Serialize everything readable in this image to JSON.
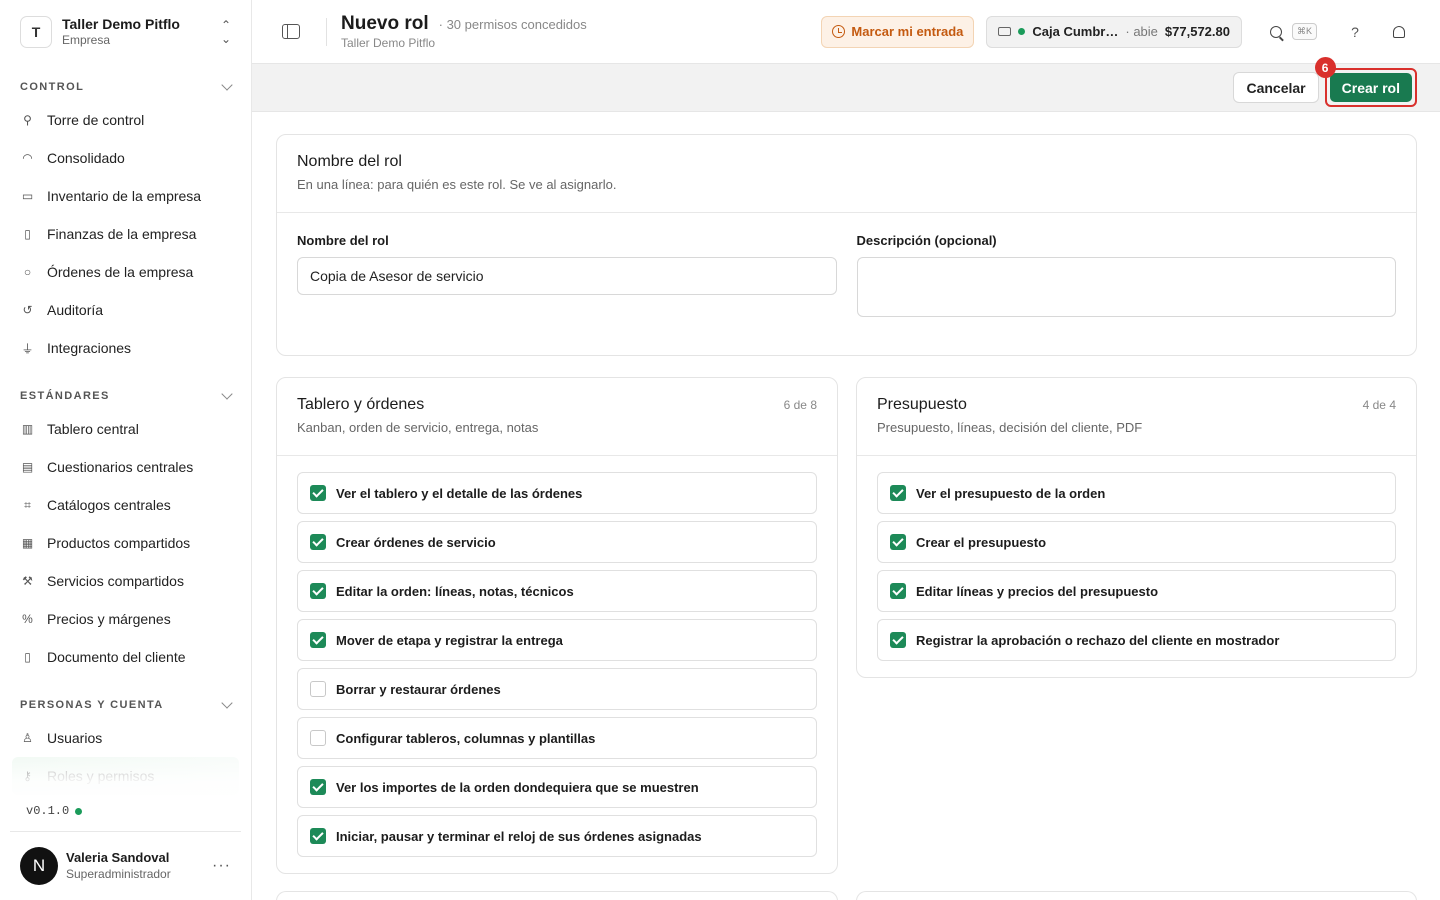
{
  "workspace": {
    "initial": "T",
    "name": "Taller Demo Pitflo",
    "type": "Empresa"
  },
  "sidebar": {
    "sections": [
      {
        "title": "CONTROL",
        "items": [
          {
            "label": "Torre de control",
            "icon": "tower-icon"
          },
          {
            "label": "Consolidado",
            "icon": "gauge-icon"
          },
          {
            "label": "Inventario de la empresa",
            "icon": "inbox-icon"
          },
          {
            "label": "Finanzas de la empresa",
            "icon": "book-icon"
          },
          {
            "label": "Órdenes de la empresa",
            "icon": "search-icon"
          },
          {
            "label": "Auditoría",
            "icon": "history-icon"
          },
          {
            "label": "Integraciones",
            "icon": "plug-icon"
          }
        ]
      },
      {
        "title": "ESTÁNDARES",
        "items": [
          {
            "label": "Tablero central",
            "icon": "columns-icon"
          },
          {
            "label": "Cuestionarios centrales",
            "icon": "clipboard-icon"
          },
          {
            "label": "Catálogos centrales",
            "icon": "workflow-icon"
          },
          {
            "label": "Productos compartidos",
            "icon": "boxes-icon"
          },
          {
            "label": "Servicios compartidos",
            "icon": "wrench-icon"
          },
          {
            "label": "Precios y márgenes",
            "icon": "percent-icon"
          },
          {
            "label": "Documento del cliente",
            "icon": "file-icon"
          }
        ]
      },
      {
        "title": "PERSONAS Y CUENTA",
        "items": [
          {
            "label": "Usuarios",
            "icon": "user-icon"
          },
          {
            "label": "Roles y permisos",
            "icon": "key-icon"
          }
        ]
      }
    ],
    "version": "v0.1.0",
    "user": {
      "initial": "N",
      "name": "Valeria Sandoval",
      "role": "Superadministrador"
    }
  },
  "header": {
    "title": "Nuevo rol",
    "meta": "30 permisos concedidos",
    "subtitle": "Taller Demo Pitflo",
    "clock_in_label": "Marcar mi entrada",
    "register": {
      "name": "Caja Cumbr…",
      "state": "abie",
      "amount": "$77,572.80"
    },
    "search_shortcut": "⌘K",
    "help": "?"
  },
  "actions": {
    "cancel": "Cancelar",
    "create": "Crear rol",
    "badge": "6"
  },
  "role_card": {
    "title": "Nombre del rol",
    "desc": "En una línea: para quién es este rol. Se ve al asignarlo.",
    "name_label": "Nombre del rol",
    "name_value": "Copia de Asesor de servicio",
    "desc_label": "Descripción (opcional)",
    "desc_value": ""
  },
  "groups": [
    {
      "title": "Tablero y órdenes",
      "desc": "Kanban, orden de servicio, entrega, notas",
      "count": "6 de 8",
      "perms": [
        {
          "label": "Ver el tablero y el detalle de las órdenes",
          "checked": true
        },
        {
          "label": "Crear órdenes de servicio",
          "checked": true
        },
        {
          "label": "Editar la orden: líneas, notas, técnicos",
          "checked": true
        },
        {
          "label": "Mover de etapa y registrar la entrega",
          "checked": true
        },
        {
          "label": "Borrar y restaurar órdenes",
          "checked": false
        },
        {
          "label": "Configurar tableros, columnas y plantillas",
          "checked": false
        },
        {
          "label": "Ver los importes de la orden dondequiera que se muestren",
          "checked": true
        },
        {
          "label": "Iniciar, pausar y terminar el reloj de sus órdenes asignadas",
          "checked": true
        }
      ]
    },
    {
      "title": "Presupuesto",
      "desc": "Presupuesto, líneas, decisión del cliente, PDF",
      "count": "4 de 4",
      "perms": [
        {
          "label": "Ver el presupuesto de la orden",
          "checked": true
        },
        {
          "label": "Crear el presupuesto",
          "checked": true
        },
        {
          "label": "Editar líneas y precios del presupuesto",
          "checked": true
        },
        {
          "label": "Registrar la aprobación o rechazo del cliente en mostrador",
          "checked": true
        }
      ]
    }
  ]
}
